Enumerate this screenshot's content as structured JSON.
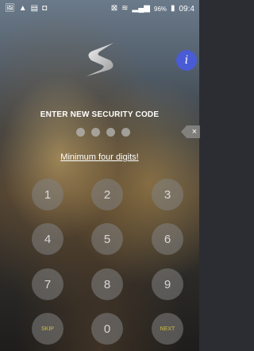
{
  "status_bar": {
    "left_icons": [
      "image-icon",
      "warning-icon",
      "document-icon",
      "camera-icon"
    ],
    "right_icons": [
      "mute-icon",
      "wifi-icon",
      "signal-icon"
    ],
    "battery_pct": "96%",
    "time": "09:4"
  },
  "logo": {
    "name": "app-logo-s"
  },
  "info_button": {
    "label": "i"
  },
  "title": "ENTER NEW SECURITY CODE",
  "pin": {
    "digits_entered": 0,
    "slots": 4
  },
  "clear_button": {
    "label": "×"
  },
  "hint": "Minimum four digits!",
  "keypad": {
    "keys": [
      "1",
      "2",
      "3",
      "4",
      "5",
      "6",
      "7",
      "8",
      "9"
    ],
    "skip_label": "SKIP",
    "zero_label": "0",
    "next_label": "NEXT"
  },
  "colors": {
    "info_blue": "#4a5bd6",
    "action_yellow": "#dcc83c"
  }
}
